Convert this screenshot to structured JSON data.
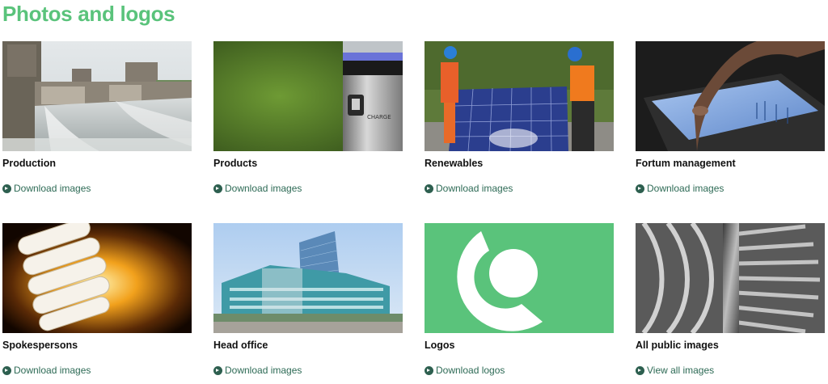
{
  "page": {
    "title": "Photos and logos"
  },
  "colors": {
    "title_green": "#5ac37b",
    "link_green": "#2d6a55",
    "logo_tile_green": "#5ac37b"
  },
  "cards": [
    {
      "title": "Production",
      "link": "Download images",
      "image": "hydro-dam-photo"
    },
    {
      "title": "Products",
      "link": "Download images",
      "image": "ev-charger-photo"
    },
    {
      "title": "Renewables",
      "link": "Download images",
      "image": "solar-panel-workers-photo"
    },
    {
      "title": "Fortum management",
      "link": "Download images",
      "image": "tablet-touch-photo"
    },
    {
      "title": "Spokespersons",
      "link": "Download images",
      "image": "energy-saving-bulb-photo"
    },
    {
      "title": "Head office",
      "link": "Download images",
      "image": "office-building-photo"
    },
    {
      "title": "Logos",
      "link": "Download logos",
      "image": "fortum-logo-tile"
    },
    {
      "title": "All public images",
      "link": "View all images",
      "image": "turbine-blades-photo"
    }
  ]
}
